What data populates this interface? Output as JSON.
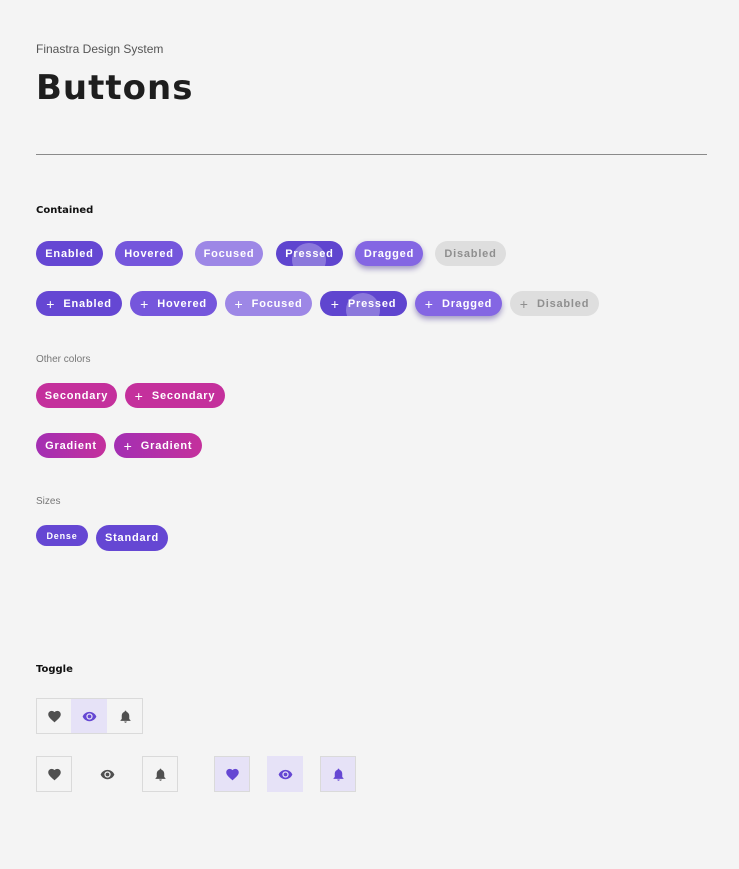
{
  "header": {
    "subtitle": "Finastra Design System",
    "title": "Buttons"
  },
  "contained": {
    "heading": "Contained",
    "row1": [
      "Enabled",
      "Hovered",
      "Focused",
      "Pressed",
      "Dragged",
      "Disabled"
    ],
    "row2": [
      "Enabled",
      "Hovered",
      "Focused",
      "Pressed",
      "Dragged",
      "Disabled"
    ],
    "plus_icon": "+"
  },
  "other_colors": {
    "heading": "Other colors",
    "secondary": "Secondary",
    "secondary_icon": "Secondary",
    "gradient": "Gradient",
    "gradient_icon": "Gradient"
  },
  "sizes": {
    "heading": "Sizes",
    "dense": "Dense",
    "standard": "Standard"
  },
  "toggle": {
    "heading": "Toggle",
    "group_icons": [
      "heart-icon",
      "eye-icon",
      "bell-icon"
    ],
    "group_selected": "eye-icon",
    "unselected_icons": [
      "heart-icon",
      "eye-icon",
      "bell-icon"
    ],
    "selected_icons": [
      "heart-icon",
      "eye-icon",
      "bell-icon"
    ]
  },
  "colors": {
    "primary": "#6547d3",
    "secondary": "#c4309c",
    "disabled": "#dedede",
    "toggle_icon": "#505050",
    "toggle_selected_icon": "#6547d3",
    "toggle_selected_bg": "#e6e2f7"
  }
}
